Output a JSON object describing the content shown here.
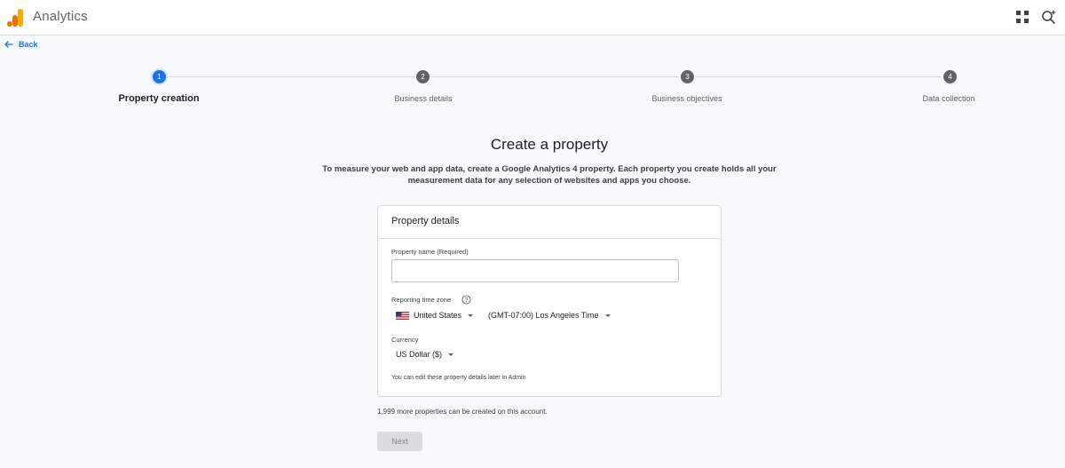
{
  "header": {
    "app_title": "Analytics",
    "logo_icon": "analytics-logo",
    "apps_icon": "grid-apps-icon",
    "search_icon": "search-sparkle-icon"
  },
  "back": {
    "label": "Back",
    "icon": "arrow-left-icon"
  },
  "stepper": {
    "steps": [
      {
        "number": "1",
        "label": "Property creation",
        "active": true
      },
      {
        "number": "2",
        "label": "Business details",
        "active": false
      },
      {
        "number": "3",
        "label": "Business objectives",
        "active": false
      },
      {
        "number": "4",
        "label": "Data collection",
        "active": false
      }
    ]
  },
  "main": {
    "title": "Create a property",
    "intro": "To measure your web and app data, create a Google Analytics 4 property. Each property you create holds all your measurement data for any selection of websites and apps you choose."
  },
  "card": {
    "title": "Property details",
    "property_name_label": "Property name (Required)",
    "property_name_value": "",
    "time_zone_label": "Reporting time zone",
    "country": "United States",
    "time_zone": "(GMT-07:00) Los Angeles Time",
    "currency_label": "Currency",
    "currency": "US Dollar ($)",
    "hint": "You can edit these property details later in Admin"
  },
  "footer": {
    "more_properties": "1,999 more properties can be created on this account.",
    "next_label": "Next"
  },
  "colors": {
    "accent": "#1a73e8",
    "logo_orange": "#f9ab00",
    "logo_dark_orange": "#e37400"
  }
}
